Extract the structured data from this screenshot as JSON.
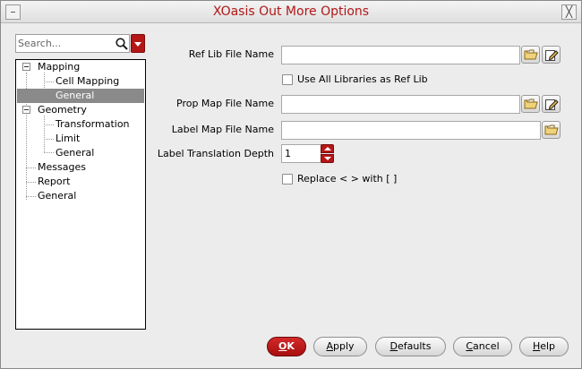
{
  "window": {
    "title": "XOasis Out More Options",
    "icons": {
      "left": "system-menu-icon",
      "right": "close-icon"
    },
    "accent_color": "#b51616",
    "selection_color": "#8a8a8a"
  },
  "search": {
    "placeholder": "Search...",
    "value": ""
  },
  "tree": {
    "items": [
      {
        "label": "Mapping"
      },
      {
        "label": "Cell Mapping"
      },
      {
        "label": "General",
        "selected": true
      },
      {
        "label": "Geometry"
      },
      {
        "label": "Transformation"
      },
      {
        "label": "Limit"
      },
      {
        "label": "General"
      },
      {
        "label": "Messages"
      },
      {
        "label": "Report"
      },
      {
        "label": "General"
      }
    ]
  },
  "form": {
    "ref_lib": {
      "label": "Ref Lib File Name",
      "value": ""
    },
    "use_all_libs": {
      "label": "Use All Libraries as Ref Lib",
      "checked": false
    },
    "prop_map": {
      "label": "Prop Map File Name",
      "value": ""
    },
    "label_map": {
      "label": "Label Map File Name",
      "value": ""
    },
    "label_depth": {
      "label": "Label Translation Depth",
      "value": "1"
    },
    "replace_brackets": {
      "label": "Replace < > with [ ]",
      "checked": false
    }
  },
  "buttons": {
    "ok": {
      "mnemonic": "O",
      "rest": "K"
    },
    "apply": {
      "mnemonic": "A",
      "rest": "pply"
    },
    "defaults": {
      "mnemonic": "D",
      "rest": "efaults"
    },
    "cancel": {
      "mnemonic": "C",
      "rest": "ancel"
    },
    "help": {
      "mnemonic": "H",
      "rest": "elp"
    }
  }
}
